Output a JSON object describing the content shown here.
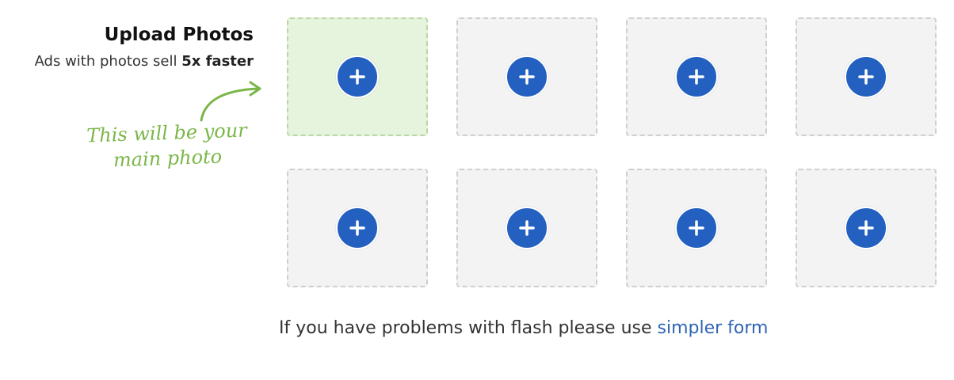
{
  "header": {
    "title": "Upload Photos",
    "subtitle_prefix": "Ads with photos sell",
    "subtitle_emphasis": "5x faster"
  },
  "hint": {
    "line1": "This will be your",
    "line2": "main photo",
    "color": "#7ab648"
  },
  "slots": [
    {
      "label": "main-photo",
      "icon": "plus-icon",
      "state": "main"
    },
    {
      "label": "photo-2",
      "icon": "plus-icon",
      "state": "empty"
    },
    {
      "label": "photo-3",
      "icon": "plus-icon",
      "state": "empty"
    },
    {
      "label": "photo-4",
      "icon": "plus-icon",
      "state": "empty"
    },
    {
      "label": "photo-5",
      "icon": "plus-icon",
      "state": "empty"
    },
    {
      "label": "photo-6",
      "icon": "plus-icon",
      "state": "empty"
    },
    {
      "label": "photo-7",
      "icon": "plus-icon",
      "state": "empty"
    },
    {
      "label": "photo-8",
      "icon": "plus-icon",
      "state": "empty"
    }
  ],
  "footer": {
    "text": "If you have problems with flash please use",
    "link": "simpler form"
  },
  "colors": {
    "accent": "#2460c0",
    "main_slot_bg": "#e7f4dd",
    "slot_bg": "#f3f3f3",
    "link": "#2f65b4"
  }
}
